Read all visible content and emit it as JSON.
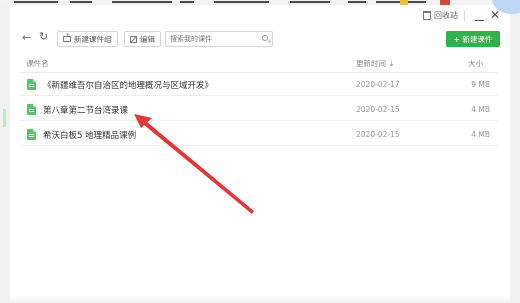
{
  "window": {
    "recycle_label": "回收站",
    "minimize_glyph": "",
    "close_glyph": "✕"
  },
  "toolbar": {
    "back_glyph": "←",
    "refresh_glyph": "↻",
    "new_folder_label": "新建课件组",
    "edit_label": "编辑",
    "search_placeholder": "搜索我的课件",
    "new_course_label": "+ 新建课件"
  },
  "table": {
    "columns": [
      "课件名",
      "更新时间 ⇣",
      "大小"
    ],
    "rows": [
      {
        "name": "《新疆维吾尔自治区的地理概况与区域开发》",
        "date": "2020-02-17",
        "size": "9 MB"
      },
      {
        "name": "第八章第二节台湾录课",
        "date": "2020-02-15",
        "size": "4 MB"
      },
      {
        "name": "希沃白板5 地理精品课例",
        "date": "2020-02-15",
        "size": "4 MB"
      }
    ]
  },
  "colors": {
    "accent_green": "#2fb24c",
    "file_icon_green": "#5cc16d",
    "arrow_red": "#e03a36"
  },
  "icons": {
    "back": "back-arrow-icon",
    "refresh": "refresh-icon",
    "folder": "folder-add-icon",
    "edit": "edit-icon",
    "search": "search-icon",
    "recycle": "trash-icon",
    "file": "file-icon",
    "annotation": "red-arrow-annotation"
  }
}
